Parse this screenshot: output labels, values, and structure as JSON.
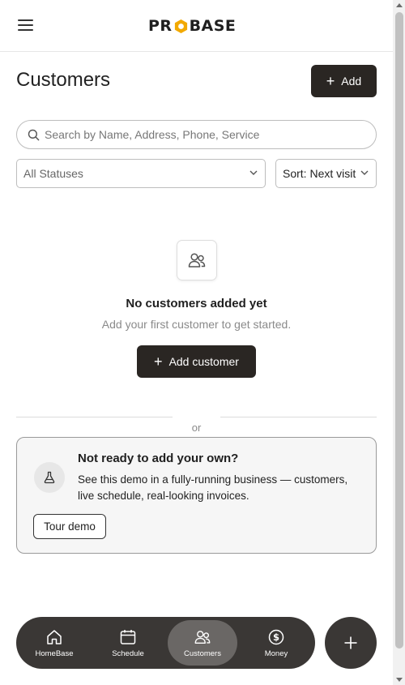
{
  "header": {
    "logo_text_left": "PR",
    "logo_text_right": "BASE",
    "brand_color": "#f2a900"
  },
  "page": {
    "title": "Customers",
    "add_label": "Add"
  },
  "search": {
    "placeholder": "Search by Name, Address, Phone, Service"
  },
  "filters": {
    "status_value": "All Statuses",
    "sort_value": "Sort: Next visit"
  },
  "empty_state": {
    "title": "No customers added yet",
    "subtitle": "Add your first customer to get started.",
    "button_label": "Add customer"
  },
  "divider": {
    "label": "or"
  },
  "demo_card": {
    "title": "Not ready to add your own?",
    "body": "See this demo in a fully-running business — customers, live schedule, real-looking invoices.",
    "button_label": "Tour demo"
  },
  "bottom_nav": {
    "items": [
      {
        "label": "HomeBase",
        "icon": "home-icon"
      },
      {
        "label": "Schedule",
        "icon": "calendar-icon"
      },
      {
        "label": "Customers",
        "icon": "users-icon"
      },
      {
        "label": "Money",
        "icon": "dollar-icon"
      }
    ],
    "active_item": "Customers"
  },
  "fab": {
    "icon": "plus-icon"
  }
}
